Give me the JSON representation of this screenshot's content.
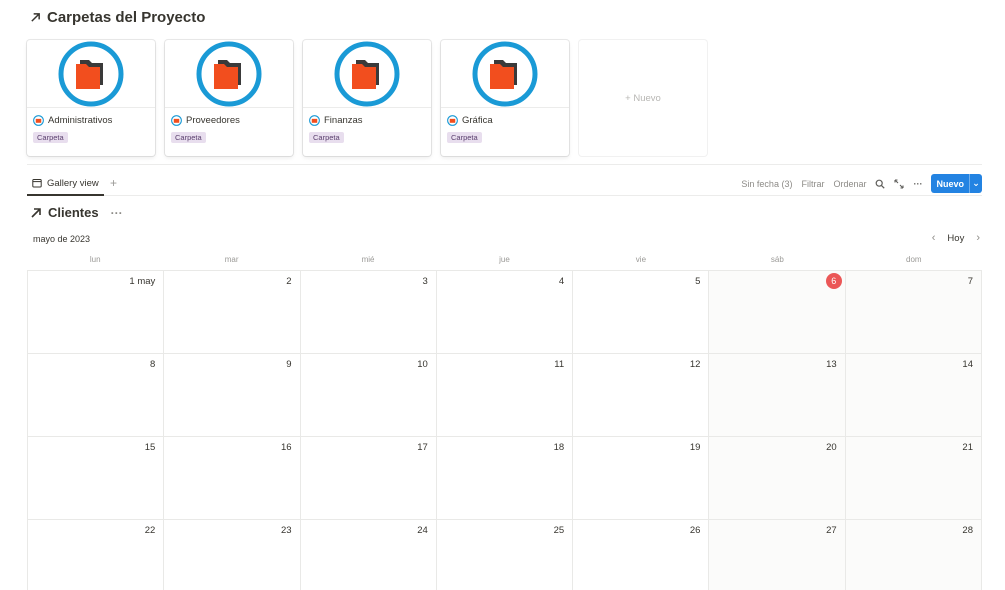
{
  "gallery": {
    "title": "Carpetas del Proyecto",
    "cards": [
      {
        "title": "Administrativos",
        "tag": "Carpeta"
      },
      {
        "title": "Proveedores",
        "tag": "Carpeta"
      },
      {
        "title": "Finanzas",
        "tag": "Carpeta"
      },
      {
        "title": "Gráfica",
        "tag": "Carpeta"
      }
    ],
    "new_label": "+ Nuevo"
  },
  "viewbar": {
    "tab_label": "Gallery view",
    "add_tab": "+",
    "no_date": "Sin fecha (3)",
    "filter": "Filtrar",
    "sort": "Ordenar",
    "more": "···",
    "new_button": "Nuevo",
    "new_chevron": "⌄"
  },
  "calendar": {
    "title": "Clientes",
    "more": "···",
    "month": "mayo de 2023",
    "today_button": "Hoy",
    "prev": "‹",
    "next": "›",
    "weekdays": [
      "lun",
      "mar",
      "mié",
      "jue",
      "vie",
      "sáb",
      "dom"
    ],
    "today": "6",
    "days": [
      "1 may",
      "2",
      "3",
      "4",
      "5",
      "6",
      "7",
      "8",
      "9",
      "10",
      "11",
      "12",
      "13",
      "14",
      "15",
      "16",
      "17",
      "18",
      "19",
      "20",
      "21",
      "22",
      "23",
      "24",
      "25",
      "26",
      "27",
      "28"
    ]
  },
  "colors": {
    "accent": "#2383e2",
    "folder": "#f24e1e",
    "folder_ring": "#1a9ad6",
    "today": "#eb5757",
    "tag_bg": "#e8deee"
  }
}
